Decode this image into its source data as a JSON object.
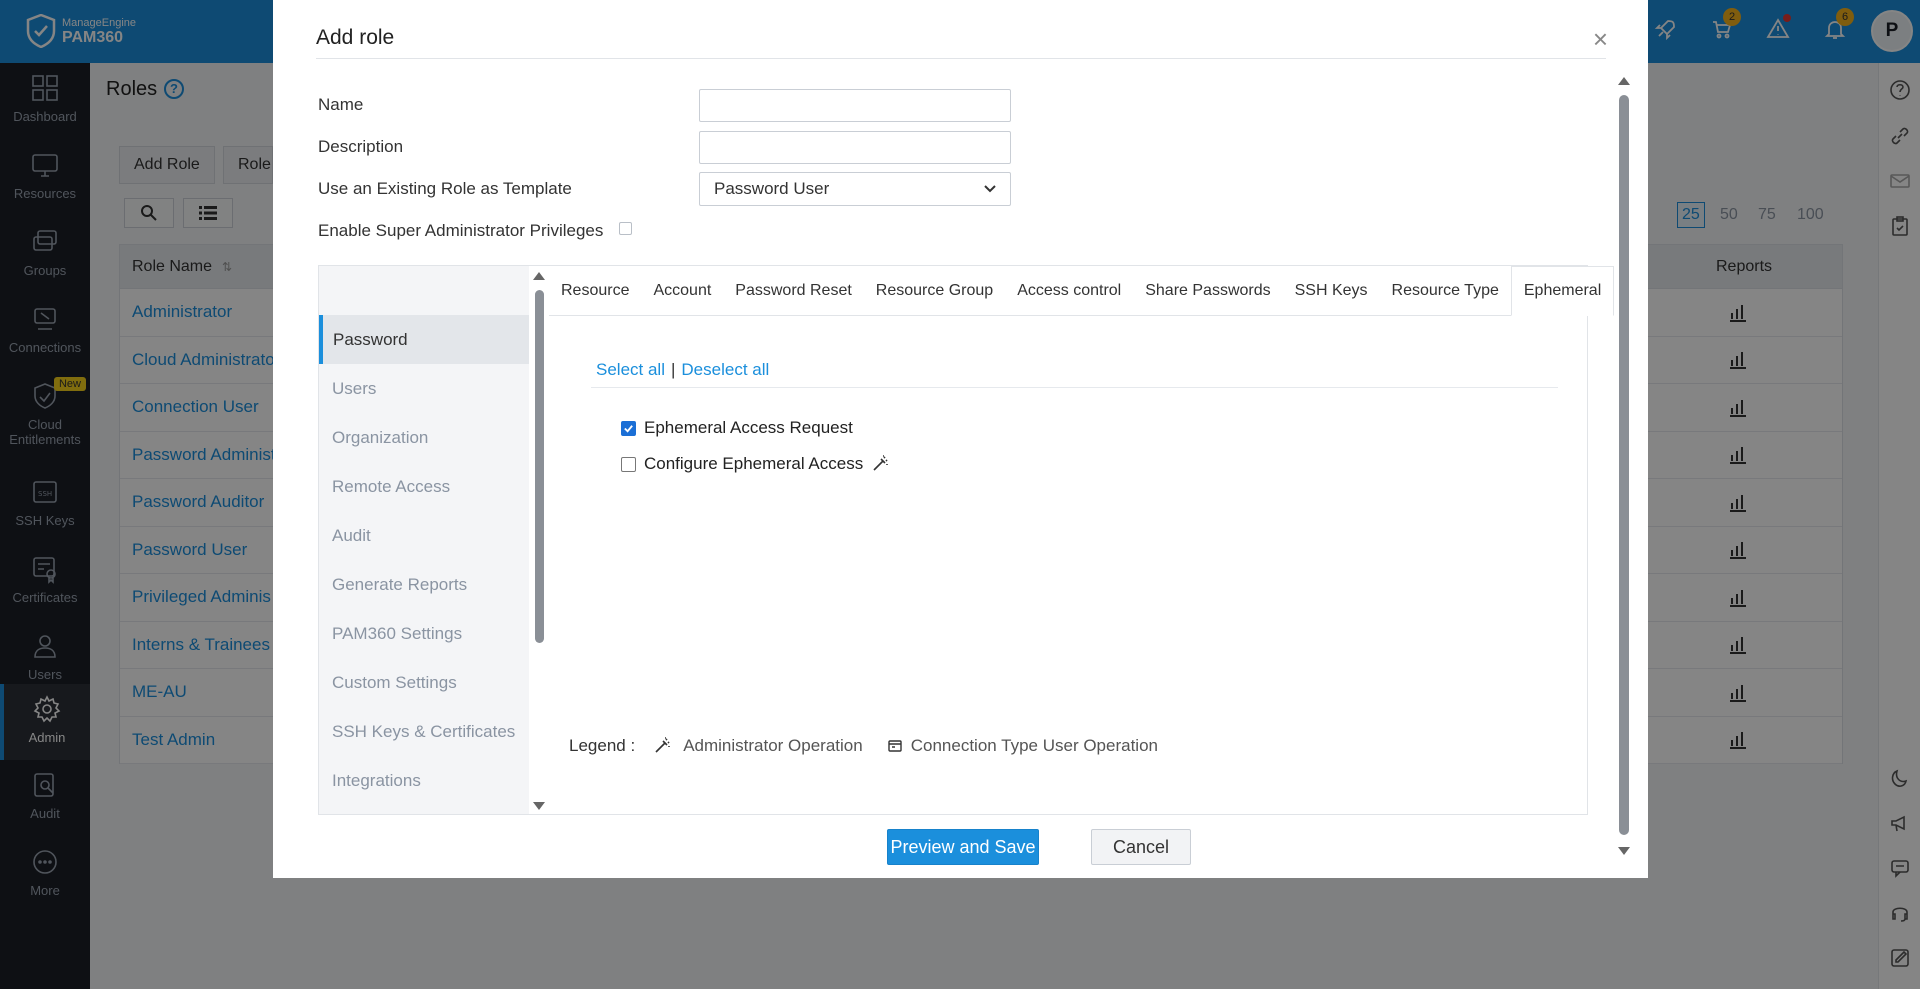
{
  "app": {
    "brand_top": "ManageEngine",
    "brand_bottom": "PAM360"
  },
  "topbar": {
    "badges": {
      "cart": "2",
      "notifications": "6"
    },
    "avatar_letter": "P"
  },
  "sidebar": {
    "items": [
      {
        "label": "Dashboard",
        "icon": "dashboard-icon"
      },
      {
        "label": "Resources",
        "icon": "monitor-icon"
      },
      {
        "label": "Groups",
        "icon": "groups-icon"
      },
      {
        "label": "Connections",
        "icon": "connections-icon"
      },
      {
        "label": "Cloud Entitlements",
        "icon": "cloud-shield-icon",
        "badge": "New"
      },
      {
        "label": "SSH Keys",
        "icon": "ssh-key-icon"
      },
      {
        "label": "Certificates",
        "icon": "certificate-icon"
      },
      {
        "label": "Users",
        "icon": "user-icon"
      },
      {
        "label": "Admin",
        "icon": "gear-icon",
        "active": true
      },
      {
        "label": "Audit",
        "icon": "audit-icon"
      },
      {
        "label": "More",
        "icon": "more-icon"
      }
    ]
  },
  "page": {
    "title": "Roles",
    "add_role_btn": "Add Role",
    "role_btn_partial": "Role",
    "table_header": "Role Name",
    "reports_header": "Reports",
    "page_sizes": [
      "25",
      "50",
      "75",
      "100"
    ],
    "selected_page_size": "25",
    "roles": [
      "Administrator",
      "Cloud Administrato",
      "Connection User",
      "Password Administ",
      "Password Auditor",
      "Password User",
      "Privileged Adminis",
      "Interns & Trainees",
      "ME-AU",
      "Test Admin"
    ]
  },
  "modal": {
    "title": "Add role",
    "close": "×",
    "fields": {
      "name_label": "Name",
      "name_value": "",
      "description_label": "Description",
      "description_value": "",
      "template_label": "Use an Existing Role as Template",
      "template_value": "Password User",
      "super_admin_label": "Enable Super Administrator Privileges",
      "super_admin_checked": false
    },
    "categories": [
      "Password",
      "Users",
      "Organization",
      "Remote Access",
      "Audit",
      "Generate Reports",
      "PAM360 Settings",
      "Custom Settings",
      "SSH Keys & Certificates",
      "Integrations"
    ],
    "active_category": "Password",
    "tabs": [
      "Resource",
      "Account",
      "Password Reset",
      "Resource Group",
      "Access control",
      "Share Passwords",
      "SSH Keys",
      "Resource Type",
      "Ephemeral"
    ],
    "active_tab": "Ephemeral",
    "select_all": "Select all",
    "separator": "|",
    "deselect_all": "Deselect all",
    "permissions": [
      {
        "label": "Ephemeral Access Request",
        "checked": true,
        "admin_op": false
      },
      {
        "label": "Configure Ephemeral Access",
        "checked": false,
        "admin_op": true
      }
    ],
    "legend": {
      "label": "Legend :",
      "admin_op": "Administrator Operation",
      "conn_op": "Connection Type User Operation"
    },
    "buttons": {
      "save": "Preview and Save",
      "cancel": "Cancel"
    }
  },
  "colors": {
    "accent": "#1b8fdc",
    "sidebar_bg": "#1b1f27",
    "badge": "#f6b21b"
  }
}
